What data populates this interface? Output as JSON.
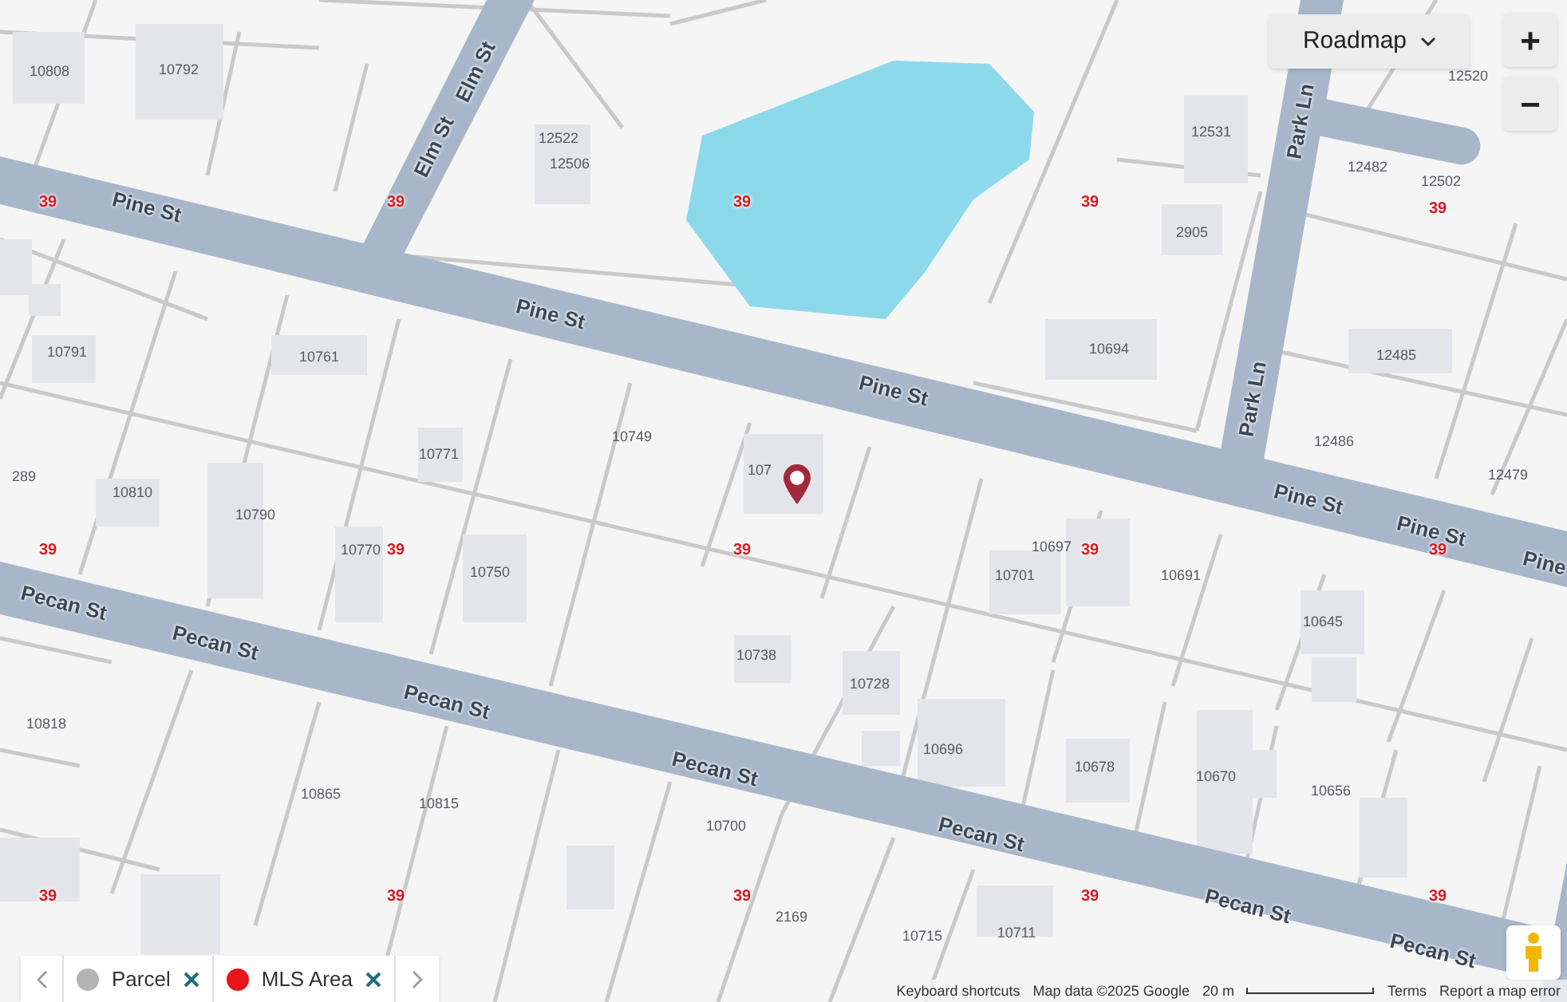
{
  "map_controls": {
    "map_type": "Roadmap",
    "zoom_in": "+",
    "zoom_out": "−"
  },
  "street_labels": [
    {
      "name": "Pine St"
    },
    {
      "name": "Pine St"
    },
    {
      "name": "Pine St"
    },
    {
      "name": "Pine St"
    },
    {
      "name": "Pine St"
    },
    {
      "name": "Pine"
    },
    {
      "name": "Elm St"
    },
    {
      "name": "Elm St"
    },
    {
      "name": "Park Ln"
    },
    {
      "name": "Park Ln"
    },
    {
      "name": "Pecan St"
    },
    {
      "name": "Pecan St"
    },
    {
      "name": "Pecan St"
    },
    {
      "name": "Pecan St"
    },
    {
      "name": "Pecan St"
    },
    {
      "name": "Pecan St"
    },
    {
      "name": "Pecan St"
    }
  ],
  "parcel_numbers": [
    "10808",
    "10792",
    "12522",
    "12506",
    "12531",
    "12520",
    "12482",
    "12502",
    "2905",
    "10694",
    "12485",
    "12486",
    "12479",
    "10791",
    "10761",
    "10771",
    "10749",
    "107",
    "10697",
    "10701",
    "10691",
    "289",
    "10810",
    "10790",
    "10770",
    "10750",
    "10645",
    "10738",
    "10728",
    "10696",
    "10678",
    "10670",
    "10656",
    "10818",
    "10865",
    "10815",
    "10700",
    "2169",
    "10715",
    "10711"
  ],
  "mls_area_labels": [
    "39",
    "39",
    "39",
    "39",
    "39",
    "39",
    "39",
    "39",
    "39",
    "39",
    "39",
    "39",
    "39",
    "39",
    "39"
  ],
  "legend": [
    {
      "label": "Parcel",
      "color": "#b4b4b4"
    },
    {
      "label": "MLS Area",
      "color": "#e8151b"
    }
  ],
  "attribution": {
    "shortcuts": "Keyboard shortcuts",
    "map_data": "Map data ©2025 Google",
    "scale": "20 m",
    "terms": "Terms",
    "report": "Report a map error"
  }
}
